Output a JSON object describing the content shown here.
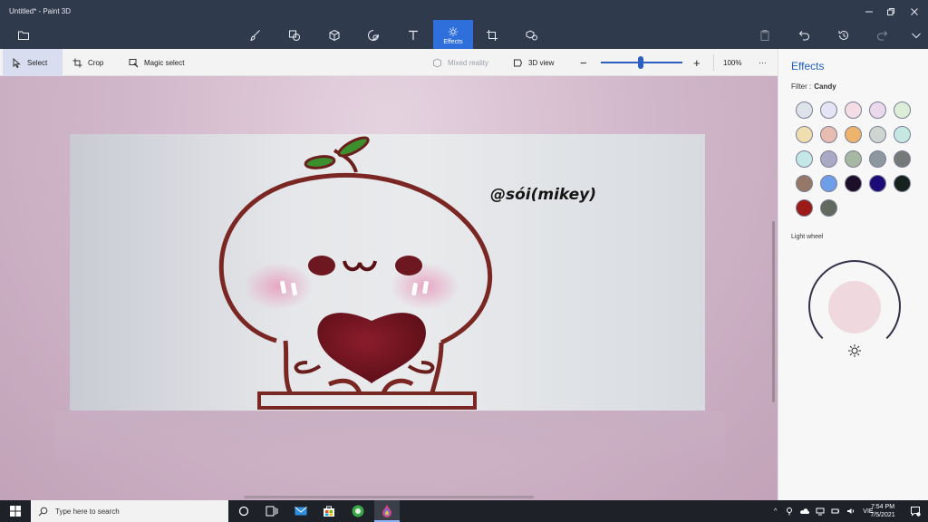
{
  "window": {
    "title": "Untitled* - Paint 3D"
  },
  "toolbar": {
    "active_label": "Effects"
  },
  "subtoolbar": {
    "select_label": "Select",
    "crop_label": "Crop",
    "magic_select_label": "Magic select",
    "mixed_reality_label": "Mixed reality",
    "view_3d_label": "3D view",
    "zoom_out": "−",
    "zoom_in": "+",
    "zoom_value": "100%",
    "more": "···",
    "zoom_level": 0.49
  },
  "canvas": {
    "watermark": "@sói(mikey)"
  },
  "panel": {
    "title": "Effects",
    "filter_label": "Filter :",
    "filter_value": "Candy",
    "light_wheel_label": "Light wheel",
    "swatches": [
      "#dde3ea",
      "#e4e4f5",
      "#f4dde4",
      "#ead9ec",
      "#dcedd8",
      "#f0deb0",
      "#e8bcb0",
      "#ecb46c",
      "#cfd6d2",
      "#c6e8e2",
      "#c3e6e6",
      "#a9a9c6",
      "#a6b8a1",
      "#8d97a0",
      "#757a78",
      "#967868",
      "#6f9ee8",
      "#1d0e2a",
      "#1d0b78",
      "#15221d",
      "#9c1a18",
      "#626a5f"
    ]
  },
  "taskbar": {
    "search_placeholder": "Type here to search",
    "language": "VIE",
    "time": "7:54 PM",
    "date": "7/5/2021"
  }
}
